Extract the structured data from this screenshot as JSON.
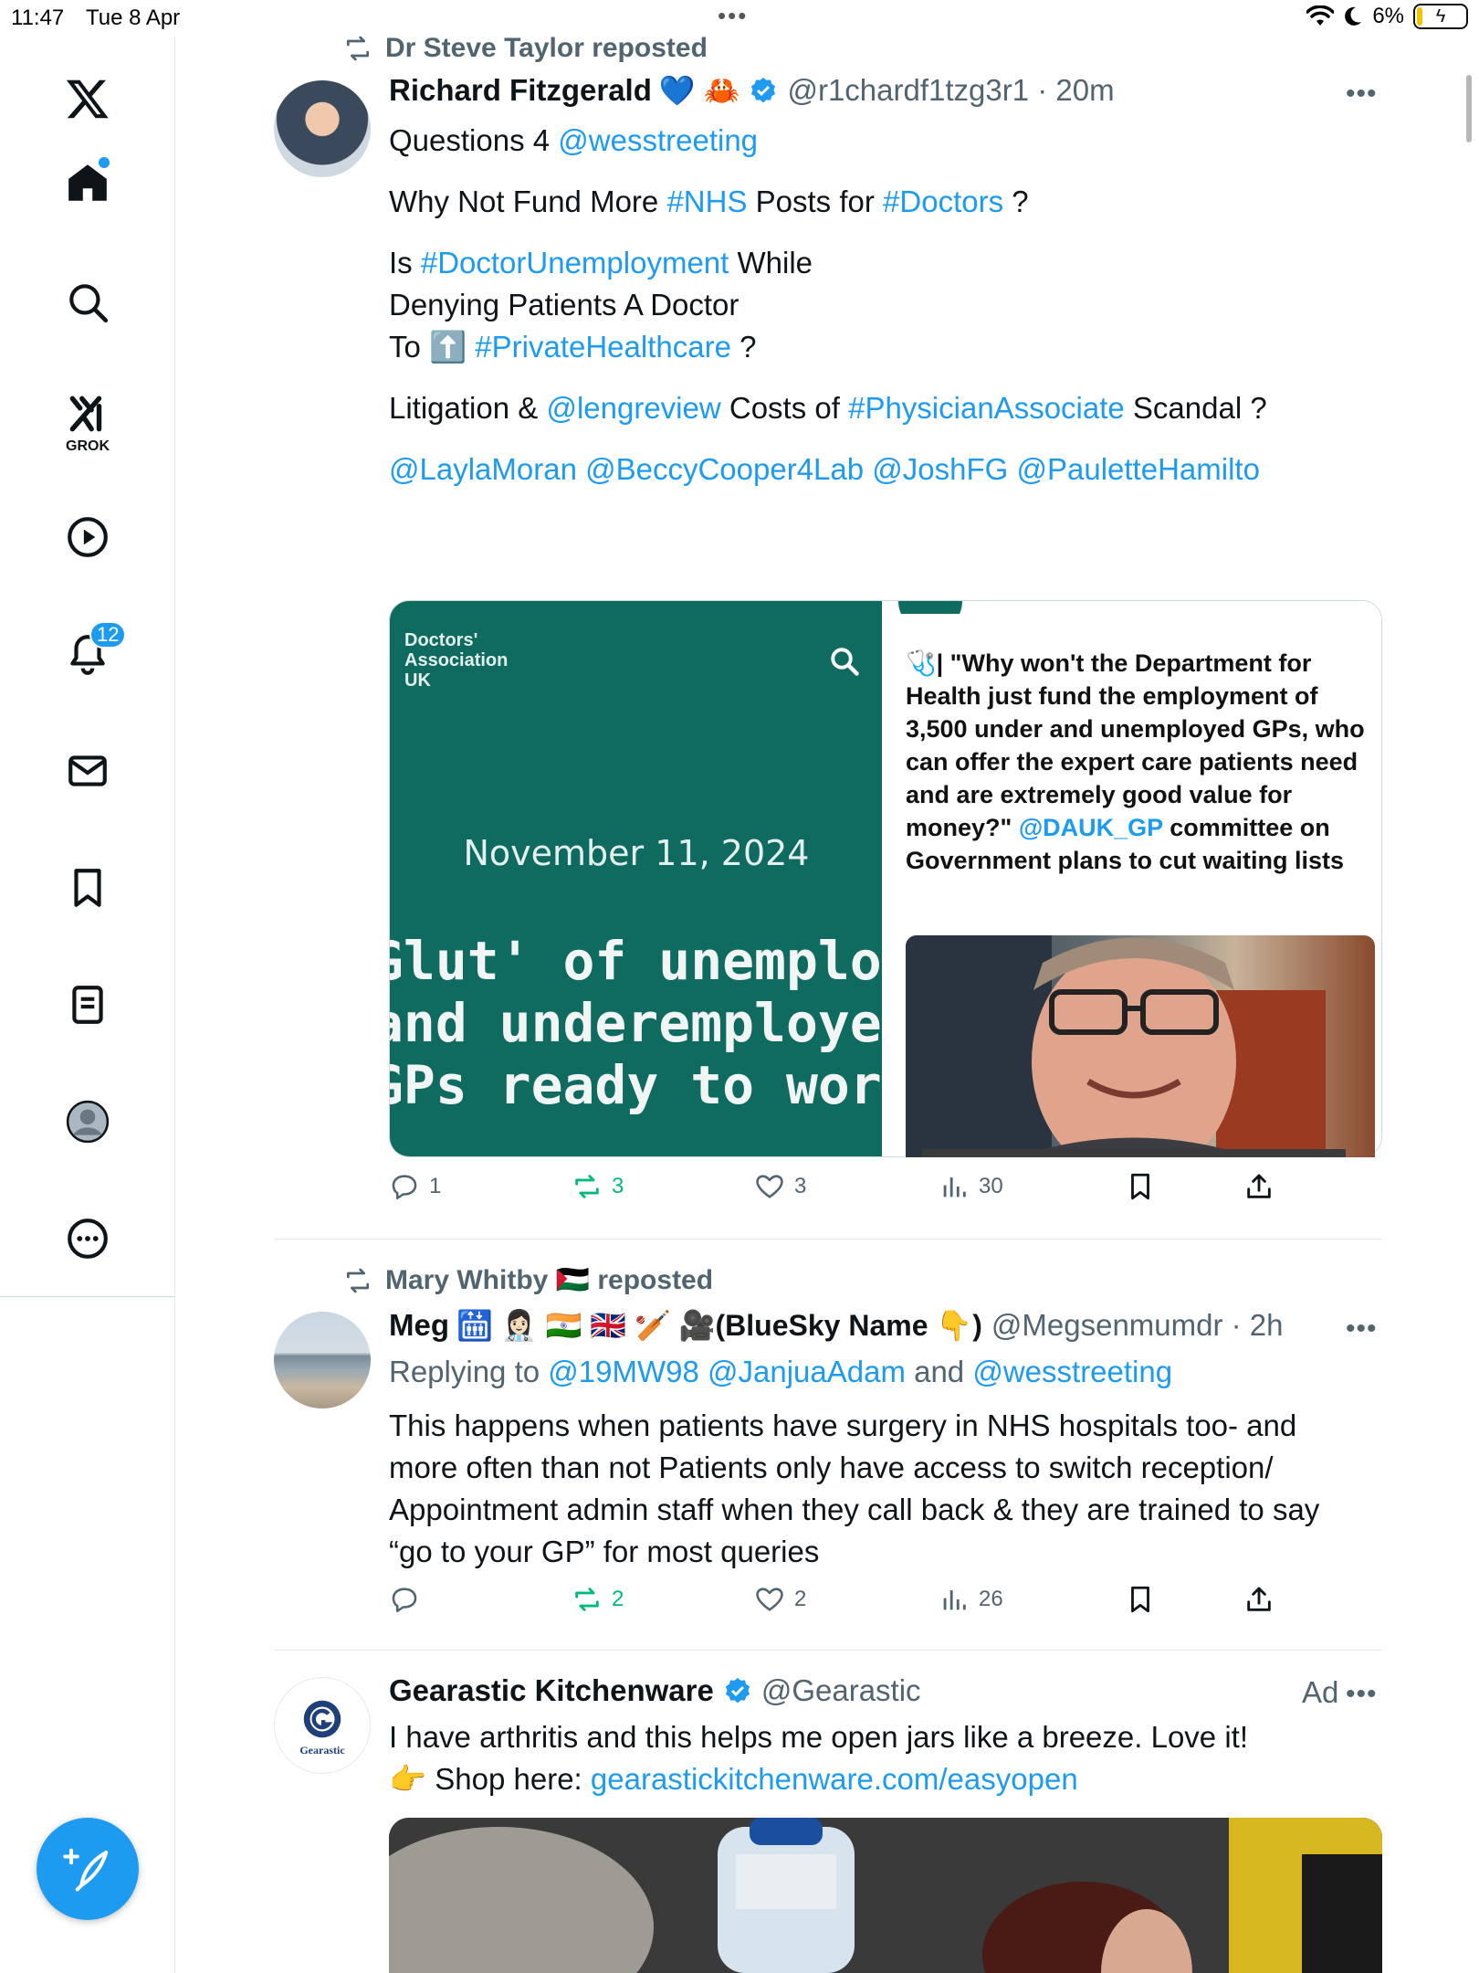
{
  "status_bar": {
    "time": "11:47",
    "date": "Tue 8 Apr",
    "battery": "6%"
  },
  "sidebar": {
    "notifications_count": "12",
    "grok_label": "GROK",
    "items": [
      "x-logo",
      "home",
      "search",
      "grok",
      "video",
      "notifications",
      "messages",
      "bookmarks",
      "lists",
      "profile",
      "more"
    ]
  },
  "posts": [
    {
      "reposted_by": "Dr Steve Taylor reposted",
      "author_name": "Richard Fitzgerald",
      "author_emoji": "💙 🦀",
      "verified": true,
      "handle_time": "@r1chardf1tzg3r1 · 20m",
      "text_lines": [
        [
          {
            "t": "Questions 4 "
          },
          {
            "t": "@wesstreeting",
            "link": true
          }
        ],
        [],
        [
          {
            "t": "Why Not Fund More "
          },
          {
            "t": "#NHS",
            "link": true
          },
          {
            "t": " Posts for "
          },
          {
            "t": "#Doctors",
            "link": true
          },
          {
            "t": " ?"
          }
        ],
        [],
        [
          {
            "t": "Is "
          },
          {
            "t": "#DoctorUnemployment",
            "link": true
          },
          {
            "t": " While"
          }
        ],
        [
          {
            "t": "Denying Patients A Doctor"
          }
        ],
        [
          {
            "t": "To ⬆️ "
          },
          {
            "t": "#PrivateHealthcare",
            "link": true
          },
          {
            "t": " ?"
          }
        ],
        [],
        [
          {
            "t": "Litigation & "
          },
          {
            "t": "@lengreview",
            "link": true
          },
          {
            "t": " Costs of "
          },
          {
            "t": "#PhysicianAssociate",
            "link": true
          },
          {
            "t": " Scandal ?"
          }
        ],
        [],
        [
          {
            "t": "@LaylaMoran @BeccyCooper4Lab @JoshFG @PauletteHamilto",
            "link": true
          }
        ]
      ],
      "media": {
        "org": [
          "Doctors'",
          "Association",
          "UK"
        ],
        "date": "November 11, 2024",
        "headline_lines": [
          "Glut' of unemployed",
          "and underemployed",
          "GPs ready to work"
        ],
        "quote_parts": [
          {
            "t": "🩺| \"Why won't the Department for Health just fund the employment of 3,500 under and unemployed GPs, who can offer the expert care patients need and are extremely good value for money?\" "
          },
          {
            "t": "@DAUK_GP",
            "link": true
          },
          {
            "t": " committee on Government plans to cut waiting lists"
          }
        ]
      },
      "actions": {
        "replies": "1",
        "reposts": "3",
        "likes": "3",
        "views": "30"
      }
    },
    {
      "reposted_by": "Mary Whitby 🇵🇸 reposted",
      "author_name": "Meg",
      "author_emoji": "🛗 👩🏻‍⚕️ 🇮🇳 🇬🇧 🏏 🎥(BlueSky Name 👇)",
      "verified": false,
      "handle_time": "@Megsenmumdr · 2h",
      "reply_to": [
        {
          "t": "Replying to "
        },
        {
          "t": "@19MW98 @JanjuaAdam",
          "link": true
        },
        {
          "t": " and "
        },
        {
          "t": "@wesstreeting",
          "link": true
        }
      ],
      "text_lines": [
        [
          {
            "t": "This happens when patients have surgery in NHS hospitals too- and"
          }
        ],
        [
          {
            "t": "more often than not Patients only have access to switch reception/"
          }
        ],
        [
          {
            "t": "Appointment admin staff when they call back & they are trained to say"
          }
        ],
        [
          {
            "t": "“go to your GP” for most queries"
          }
        ]
      ],
      "actions": {
        "replies": "",
        "reposts": "2",
        "likes": "2",
        "views": "26"
      }
    },
    {
      "author_name": "Gearastic Kitchenware",
      "verified": true,
      "handle_time": "@Gearastic",
      "ad_label": "Ad",
      "avatar_text": "Gearastic",
      "text_lines": [
        [
          {
            "t": "I have arthritis and this helps me open jars like a breeze. Love it!"
          }
        ],
        [
          {
            "t": "👉 Shop here: "
          },
          {
            "t": "gearastickitchenware.com/easyopen",
            "link": true
          }
        ]
      ]
    }
  ],
  "colors": {
    "accent": "#1d9bf0",
    "repost_green": "#00ba7c",
    "secondary_text": "#536471",
    "media_teal": "#0f6b60"
  }
}
